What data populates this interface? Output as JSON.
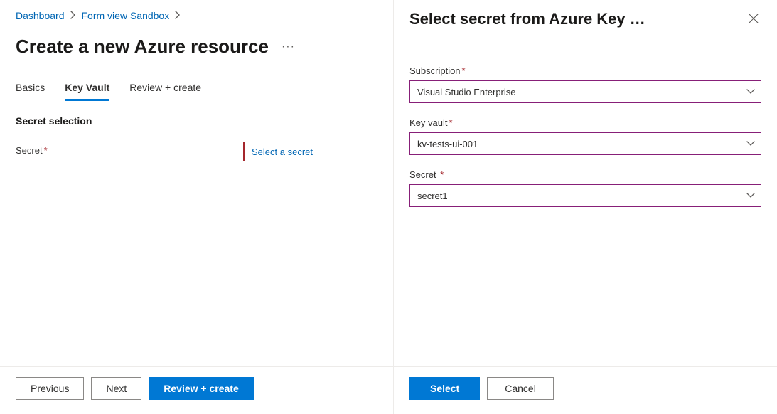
{
  "breadcrumb": {
    "items": [
      {
        "label": "Dashboard"
      },
      {
        "label": "Form view Sandbox"
      }
    ]
  },
  "main": {
    "title": "Create a new Azure resource",
    "tabs": [
      {
        "label": "Basics",
        "active": false
      },
      {
        "label": "Key Vault",
        "active": true
      },
      {
        "label": "Review + create",
        "active": false
      }
    ],
    "section_heading": "Secret selection",
    "secret_field_label": "Secret",
    "select_secret_link": "Select a secret",
    "footer": {
      "previous": "Previous",
      "next": "Next",
      "review_create": "Review + create"
    }
  },
  "panel": {
    "title": "Select secret from Azure Key …",
    "fields": {
      "subscription": {
        "label": "Subscription",
        "value": "Visual Studio Enterprise"
      },
      "keyvault": {
        "label": "Key vault",
        "value": "kv-tests-ui-001"
      },
      "secret": {
        "label": "Secret",
        "value": "secret1"
      }
    },
    "footer": {
      "select": "Select",
      "cancel": "Cancel"
    }
  }
}
